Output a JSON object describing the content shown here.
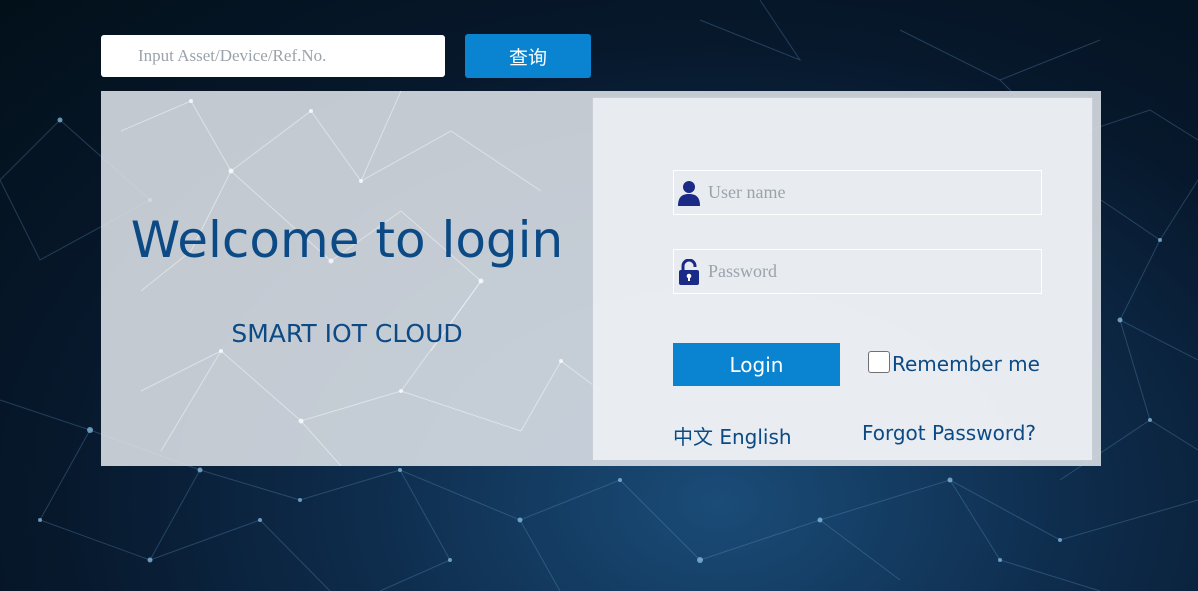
{
  "search": {
    "placeholder": "Input Asset/Device/Ref.No.",
    "button_label": "查询"
  },
  "welcome": {
    "title": "Welcome to login",
    "subtitle": "SMART IOT CLOUD"
  },
  "login_form": {
    "username_placeholder": "User name",
    "password_placeholder": "Password",
    "login_button_label": "Login",
    "remember_label": "Remember me",
    "remember_checked": false,
    "lang_chinese": "中文",
    "lang_english": "English",
    "forgot_label": "Forgot Password?"
  },
  "icons": {
    "user": "user-icon",
    "lock": "lock-icon"
  },
  "colors": {
    "accent": "#0a84d0",
    "text_brand": "#0c4a86",
    "icon": "#1b2a86"
  }
}
